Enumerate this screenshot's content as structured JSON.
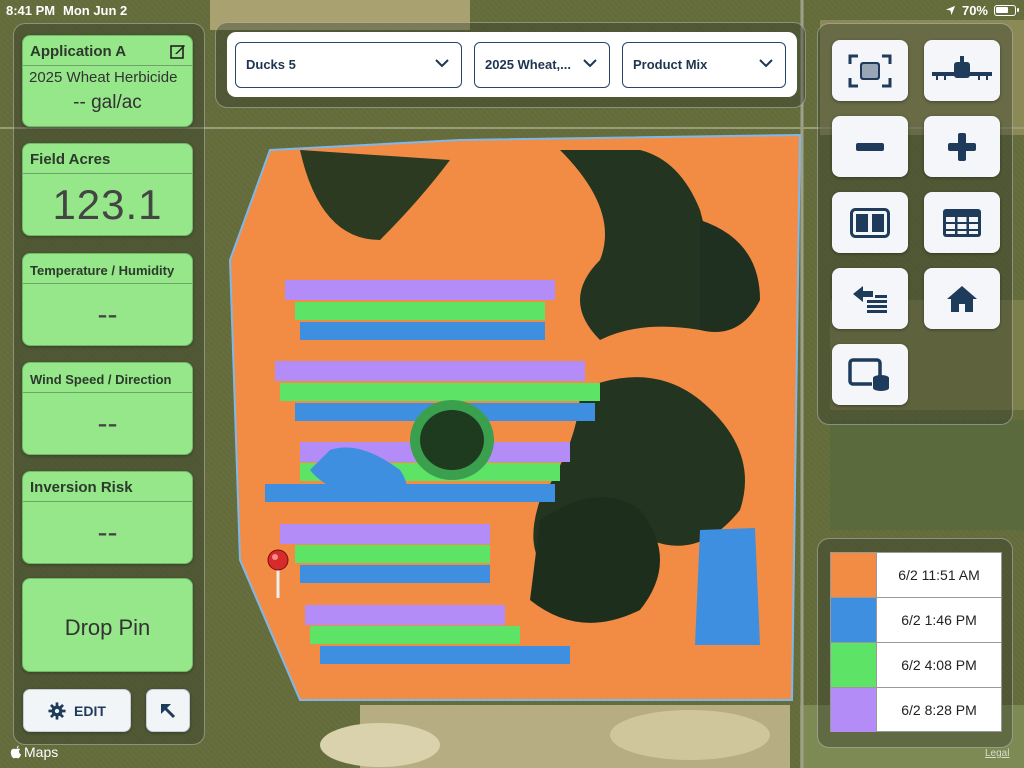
{
  "status_bar": {
    "time": "8:41 PM",
    "date": "Mon Jun 2",
    "battery": "70%"
  },
  "cards": {
    "application": {
      "title": "Application A",
      "product": "2025 Wheat Herbicide",
      "rate": "-- gal/ac"
    },
    "field_acres": {
      "title": "Field Acres",
      "value": "123.1"
    },
    "temperature": {
      "title": "Temperature / Humidity",
      "value": "--"
    },
    "wind": {
      "title": "Wind Speed / Direction",
      "value": "--"
    },
    "inversion": {
      "title": "Inversion Risk",
      "value": "--"
    },
    "drop_pin": {
      "label": "Drop Pin"
    }
  },
  "edit_button": {
    "label": "EDIT"
  },
  "dropdowns": [
    {
      "label": "Ducks 5"
    },
    {
      "label": "2025 Wheat,..."
    },
    {
      "label": "Product Mix"
    }
  ],
  "tools": [
    {
      "name": "fit-to-screen-icon"
    },
    {
      "name": "sprayer-icon"
    },
    {
      "name": "zoom-out-icon"
    },
    {
      "name": "zoom-in-icon"
    },
    {
      "name": "split-view-icon"
    },
    {
      "name": "table-icon"
    },
    {
      "name": "back-list-icon"
    },
    {
      "name": "home-icon"
    },
    {
      "name": "screen-database-icon"
    }
  ],
  "legend": [
    {
      "color": "#f28c45",
      "label": "6/2 11:51 AM"
    },
    {
      "color": "#3f8fe0",
      "label": "6/2 1:46 PM"
    },
    {
      "color": "#5de366",
      "label": "6/2 4:08 PM"
    },
    {
      "color": "#b48cf7",
      "label": "6/2 8:28 PM"
    }
  ],
  "map": {
    "attribution": "Maps",
    "legal": "Legal"
  },
  "colors": {
    "card_green": "#96e68a",
    "navy": "#1f3b5c",
    "orange": "#f28c45",
    "blue": "#3f8fe0",
    "green": "#5de366",
    "purple": "#b48cf7"
  }
}
